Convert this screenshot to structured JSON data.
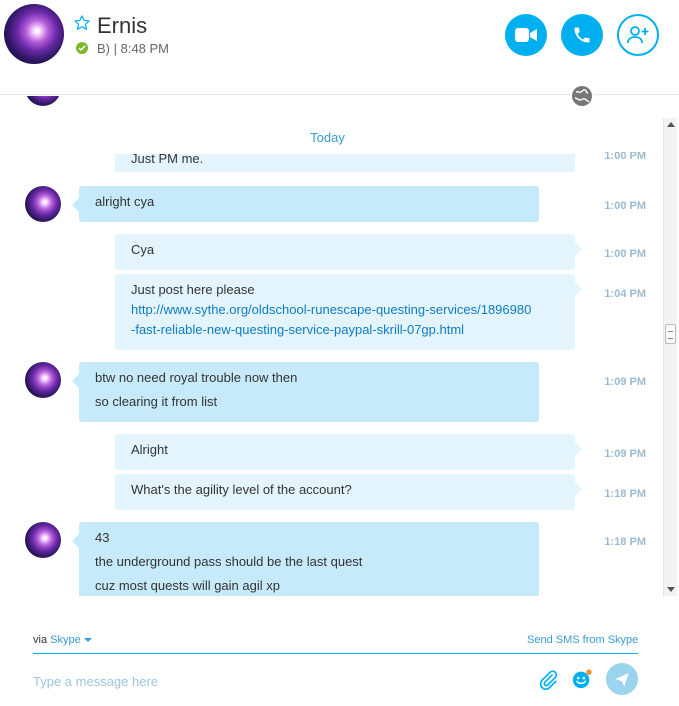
{
  "header": {
    "contact_name": "Ernis",
    "mood": "B) | 8:48 PM",
    "colors": {
      "accent": "#00aff0",
      "presence": "#7cb82f"
    },
    "icons": [
      "avatar",
      "star-icon",
      "presence-icon",
      "video-call-icon",
      "voice-call-icon",
      "add-contact-icon",
      "globe-icon"
    ]
  },
  "conversation": {
    "day_label": "Today",
    "partial_message": {
      "text": "Just PM me.",
      "time": "1:00 PM"
    },
    "groups": [
      {
        "sender": "contact",
        "lines": [
          "alright cya"
        ],
        "times": [
          "1:00 PM"
        ]
      },
      {
        "sender": "me",
        "lines": [
          "Cya"
        ],
        "times": [
          "1:00 PM"
        ]
      },
      {
        "sender": "me",
        "lines": [
          "Just post here please"
        ],
        "link": "http://www.sythe.org/oldschool-runescape-questing-services/1896980-fast-reliable-new-questing-service-paypal-skrill-07gp.html",
        "link_line1": "http://www.sythe.org/oldschool-runescape-questing-services/1896980",
        "link_line2": "-fast-reliable-new-questing-service-paypal-skrill-07gp.html",
        "times": [
          "1:04 PM"
        ]
      },
      {
        "sender": "contact",
        "lines": [
          "btw no need royal trouble now then",
          "so clearing it from list"
        ],
        "times": [
          "1:09 PM"
        ]
      },
      {
        "sender": "me",
        "lines": [
          "Alright"
        ],
        "times": [
          "1:09 PM"
        ]
      },
      {
        "sender": "me",
        "lines": [
          "What's the agility level of the account?"
        ],
        "times": [
          "1:18 PM"
        ]
      },
      {
        "sender": "contact",
        "lines": [
          "43",
          "the underground pass should be the last quest",
          "cuz most quests will gain agil xp"
        ],
        "times": [
          "1:18 PM"
        ]
      }
    ]
  },
  "footer": {
    "via_prefix": "via",
    "via_service": "Skype",
    "sms_link": "Send SMS from Skype",
    "input_placeholder": "Type a message here"
  }
}
